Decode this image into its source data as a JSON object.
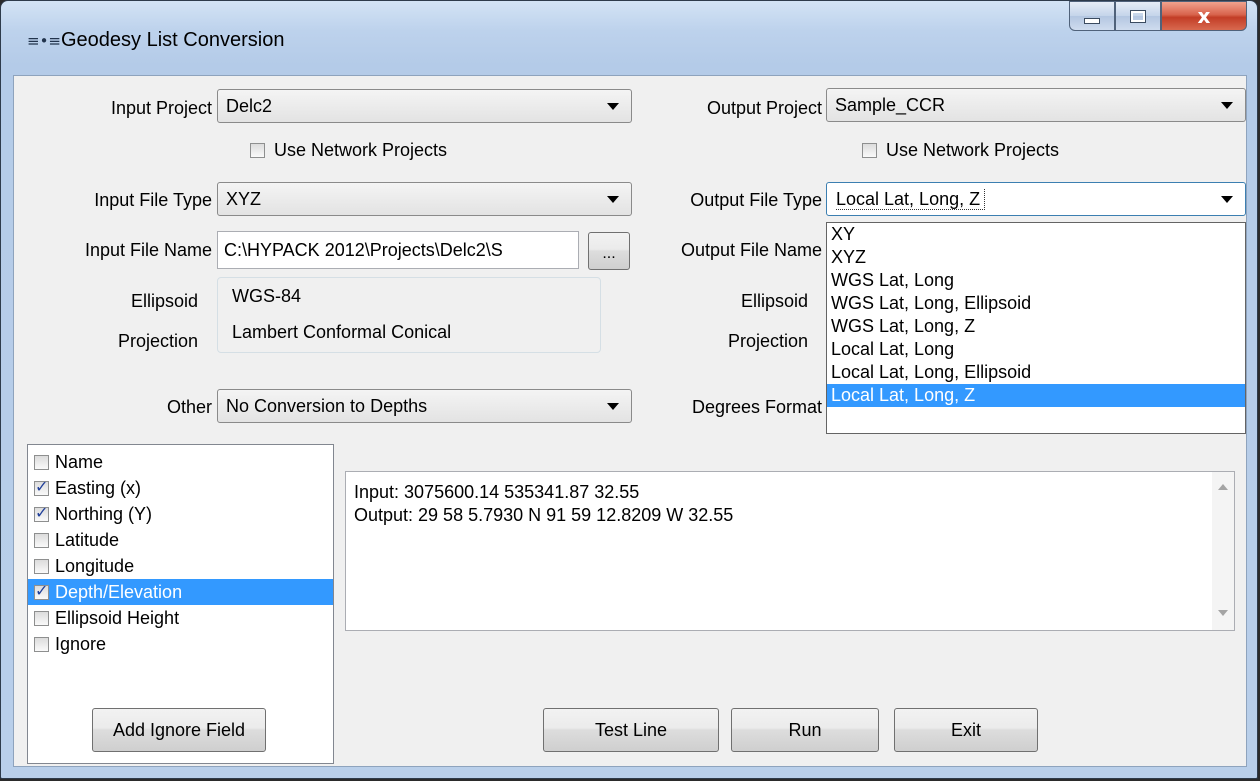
{
  "window": {
    "title": "Geodesy List Conversion",
    "app_icon": "≡•≡",
    "close_glyph": "x"
  },
  "input": {
    "project_label": "Input Project",
    "project_value": "Delc2",
    "use_network_label": "Use Network Projects",
    "use_network_checked": false,
    "file_type_label": "Input File Type",
    "file_type_value": "XYZ",
    "file_name_label": "Input File Name",
    "file_name_value": "C:\\HYPACK 2012\\Projects\\Delc2\\S",
    "browse_label": "...",
    "ellipsoid_label": "Ellipsoid",
    "projection_label": "Projection",
    "ellipsoid_value": "WGS-84",
    "projection_value": "Lambert Conformal Conical",
    "other_label": "Other",
    "other_value": "No Conversion to Depths"
  },
  "output": {
    "project_label": "Output Project",
    "project_value": "Sample_CCR",
    "use_network_label": "Use Network Projects",
    "use_network_checked": false,
    "file_type_label": "Output File Type",
    "file_type_value": "Local Lat, Long, Z",
    "file_name_label": "Output File Name",
    "ellipsoid_label": "Ellipsoid",
    "projection_label": "Projection",
    "degrees_format_label": "Degrees Format"
  },
  "file_type_dropdown": {
    "options": [
      "XY",
      "XYZ",
      "WGS Lat, Long",
      "WGS Lat, Long, Ellipsoid",
      "WGS Lat, Long, Z",
      "Local Lat, Long",
      "Local Lat, Long, Ellipsoid",
      "Local Lat, Long, Z"
    ],
    "selected_index": 7
  },
  "fields": [
    {
      "label": "Name",
      "checked": false
    },
    {
      "label": "Easting (x)",
      "checked": true
    },
    {
      "label": "Northing (Y)",
      "checked": true
    },
    {
      "label": "Latitude",
      "checked": false
    },
    {
      "label": "Longitude",
      "checked": false
    },
    {
      "label": "Depth/Elevation",
      "checked": true
    },
    {
      "label": "Ellipsoid Height",
      "checked": false
    },
    {
      "label": "Ignore",
      "checked": false
    }
  ],
  "fields_selected_index": 5,
  "preview": {
    "input_line": "Input: 3075600.14 535341.87 32.55",
    "output_line": "Output: 29 58 5.7930 N 91 59 12.8209 W 32.55"
  },
  "buttons": {
    "add_ignore": "Add Ignore Field",
    "test_line": "Test Line",
    "run": "Run",
    "exit": "Exit"
  }
}
